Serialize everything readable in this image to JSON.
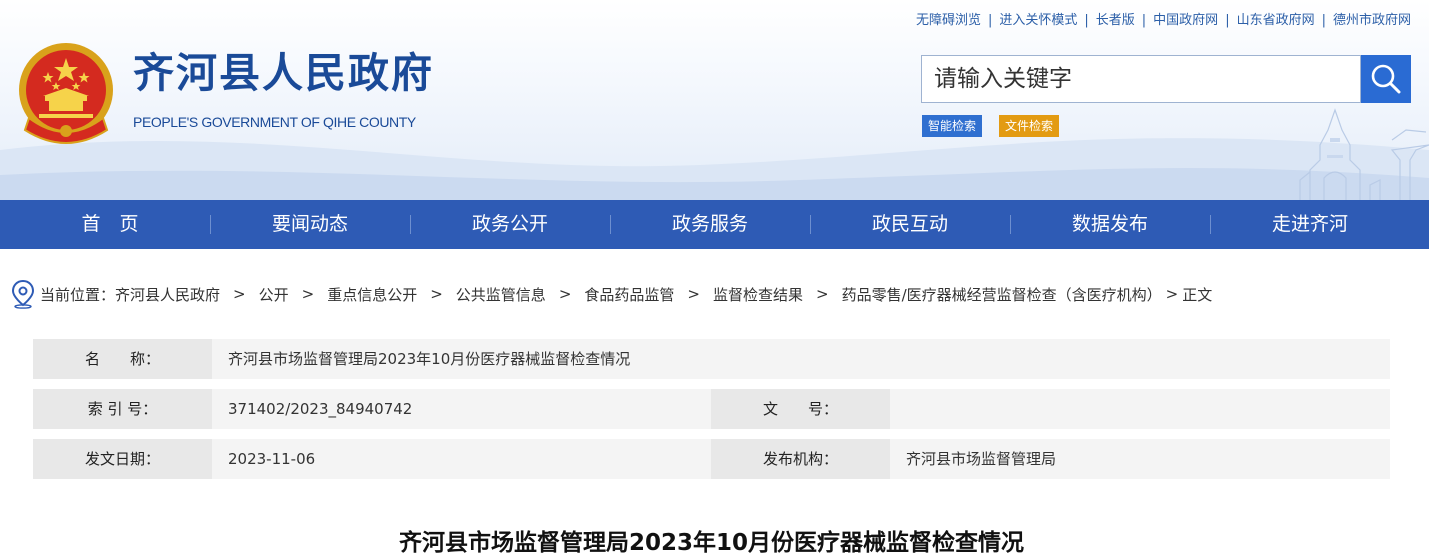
{
  "top_links": [
    "无障碍浏览",
    "进入关怀模式",
    "长者版",
    "中国政府网",
    "山东省政府网",
    "德州市政府网"
  ],
  "site": {
    "title": "齐河县人民政府",
    "subtitle": "PEOPLE'S GOVERNMENT OF QIHE COUNTY"
  },
  "search": {
    "placeholder": "请输入关键字",
    "value": "",
    "smart_search": "智能检索",
    "file_search": "文件检索"
  },
  "nav": [
    "首　页",
    "要闻动态",
    "政务公开",
    "政务服务",
    "政民互动",
    "数据发布",
    "走进齐河"
  ],
  "breadcrumb": {
    "prefix": "当前位置：",
    "items": [
      "齐河县人民政府",
      "公开",
      "重点信息公开",
      "公共监管信息",
      "食品药品监管",
      "监督检查结果",
      "药品零售/医疗器械经营监督检查（含医疗机构）"
    ],
    "current": "正文"
  },
  "info": {
    "name_label": "名　　称：",
    "name_value": "齐河县市场监督管理局2023年10月份医疗器械监督检查情况",
    "index_label": "索 引 号：",
    "index_value": "371402/2023_84940742",
    "doc_no_label": "文　　号：",
    "doc_no_value": "",
    "date_label": "发文日期：",
    "date_value": "2023-11-06",
    "org_label": "发布机构：",
    "org_value": "齐河县市场监督管理局"
  },
  "article": {
    "title": "齐河县市场监督管理局2023年10月份医疗器械监督检查情况"
  },
  "colors": {
    "nav_bg": "#2e5bb5",
    "brand_blue": "#1a4a98",
    "search_btn": "#2a6bd3",
    "tag_smart": "#2f6fd0",
    "tag_file": "#e39b12"
  }
}
